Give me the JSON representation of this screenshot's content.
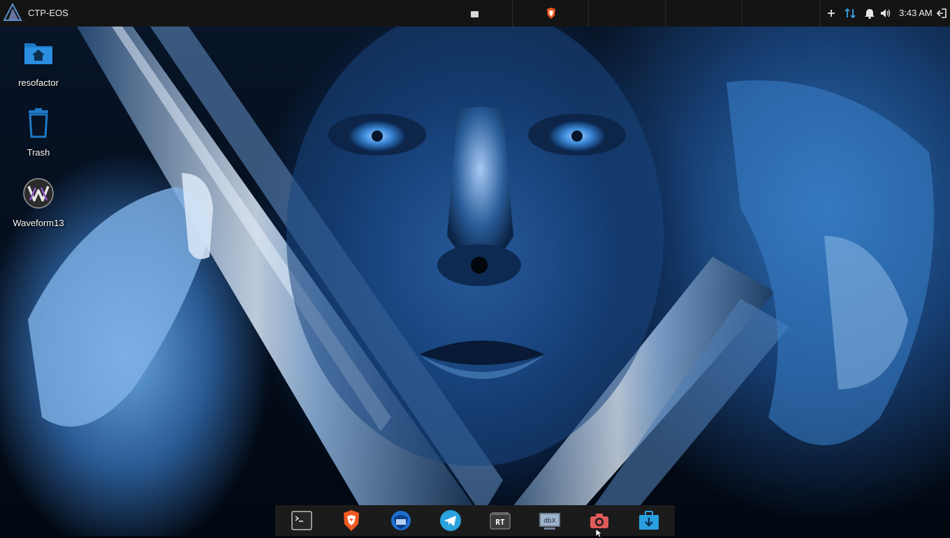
{
  "topbar": {
    "title": "CTP-EOS",
    "clock": "3:43 AM",
    "tray": {
      "add_icon": "plus-icon",
      "network_icon": "network-transfer-icon",
      "notifications_icon": "bell-icon",
      "volume_icon": "speaker-icon",
      "logout_icon": "logout-icon"
    }
  },
  "desktop": {
    "icons": [
      {
        "label": "resofactor",
        "icon": "home-folder-icon"
      },
      {
        "label": "Trash",
        "icon": "trash-icon"
      },
      {
        "label": "Waveform13",
        "icon": "waveform-app-icon"
      }
    ]
  },
  "dock": {
    "items": [
      {
        "name": "terminal",
        "icon": "terminal-icon"
      },
      {
        "name": "brave-browser",
        "icon": "brave-lion-icon"
      },
      {
        "name": "thunderbird",
        "icon": "thunderbird-icon"
      },
      {
        "name": "telegram",
        "icon": "telegram-icon"
      },
      {
        "name": "rt-app",
        "icon": "rt-app-icon"
      },
      {
        "name": "dbx",
        "icon": "dbx-icon"
      },
      {
        "name": "screenshot",
        "icon": "camera-icon"
      },
      {
        "name": "software-installer",
        "icon": "briefcase-download-icon"
      }
    ]
  },
  "colors": {
    "topbar_bg": "#141414",
    "dock_bg": "#1b1b1b",
    "folder_blue": "#1d79c4",
    "brave_orange": "#f15a24",
    "telegram_blue": "#2aa3de",
    "camera_red": "#e05a5a"
  }
}
